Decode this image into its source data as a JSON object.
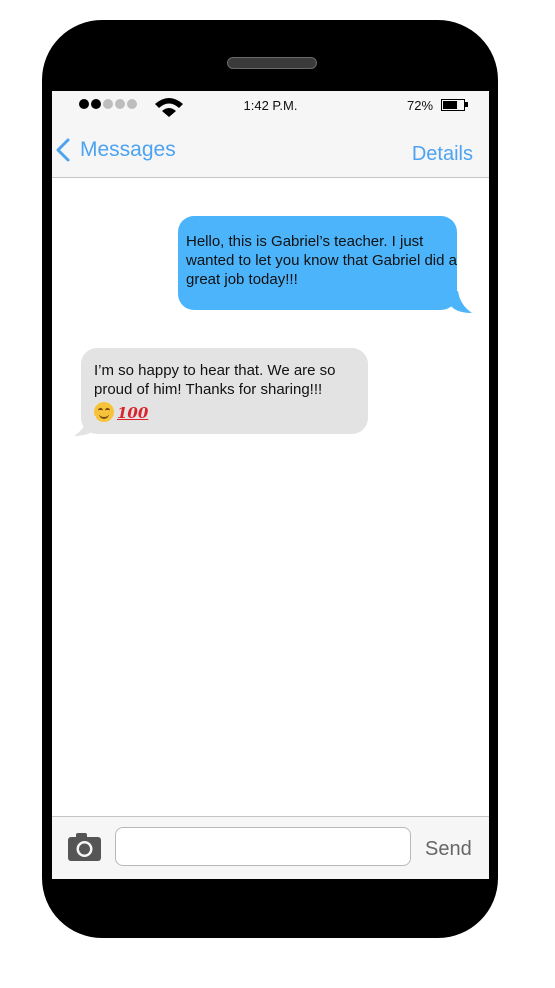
{
  "status_bar": {
    "time": "1:42 P.M.",
    "battery_percent_label": "72%",
    "battery_level": 0.72,
    "signal_strength": 2,
    "signal_max": 5
  },
  "nav": {
    "back_label": "Messages",
    "details_label": "Details"
  },
  "messages": [
    {
      "direction": "outgoing",
      "text": "Hello, this is Gabriel’s teacher.  I just wanted to let you know that Gabriel did a great job today!!!"
    },
    {
      "direction": "incoming",
      "text": "I’m so happy to hear that.  We are so proud of him! Thanks for sharing!!!",
      "emojis": [
        "smiling-face-icon",
        "hundred-points-icon"
      ],
      "hundred_label": "100"
    }
  ],
  "composer": {
    "input_value": "",
    "placeholder": "",
    "send_label": "Send"
  },
  "colors": {
    "accent": "#4da3f0",
    "outgoing_bubble": "#4cb4fb",
    "incoming_bubble": "#e3e3e3",
    "phone_frame": "#000000"
  }
}
